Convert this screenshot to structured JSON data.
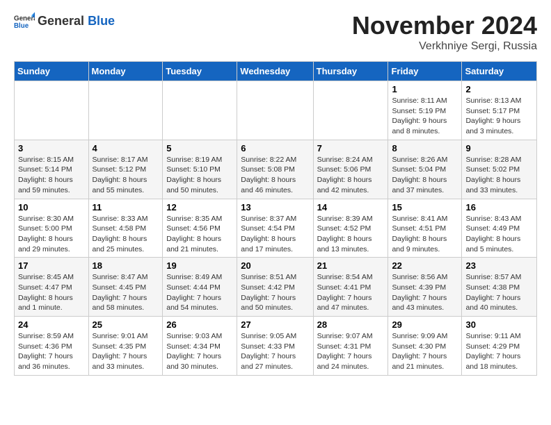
{
  "logo": {
    "general": "General",
    "blue": "Blue"
  },
  "header": {
    "month_title": "November 2024",
    "location": "Verkhniye Sergi, Russia"
  },
  "weekdays": [
    "Sunday",
    "Monday",
    "Tuesday",
    "Wednesday",
    "Thursday",
    "Friday",
    "Saturday"
  ],
  "weeks": [
    [
      {
        "day": "",
        "info": ""
      },
      {
        "day": "",
        "info": ""
      },
      {
        "day": "",
        "info": ""
      },
      {
        "day": "",
        "info": ""
      },
      {
        "day": "",
        "info": ""
      },
      {
        "day": "1",
        "info": "Sunrise: 8:11 AM\nSunset: 5:19 PM\nDaylight: 9 hours\nand 8 minutes."
      },
      {
        "day": "2",
        "info": "Sunrise: 8:13 AM\nSunset: 5:17 PM\nDaylight: 9 hours\nand 3 minutes."
      }
    ],
    [
      {
        "day": "3",
        "info": "Sunrise: 8:15 AM\nSunset: 5:14 PM\nDaylight: 8 hours\nand 59 minutes."
      },
      {
        "day": "4",
        "info": "Sunrise: 8:17 AM\nSunset: 5:12 PM\nDaylight: 8 hours\nand 55 minutes."
      },
      {
        "day": "5",
        "info": "Sunrise: 8:19 AM\nSunset: 5:10 PM\nDaylight: 8 hours\nand 50 minutes."
      },
      {
        "day": "6",
        "info": "Sunrise: 8:22 AM\nSunset: 5:08 PM\nDaylight: 8 hours\nand 46 minutes."
      },
      {
        "day": "7",
        "info": "Sunrise: 8:24 AM\nSunset: 5:06 PM\nDaylight: 8 hours\nand 42 minutes."
      },
      {
        "day": "8",
        "info": "Sunrise: 8:26 AM\nSunset: 5:04 PM\nDaylight: 8 hours\nand 37 minutes."
      },
      {
        "day": "9",
        "info": "Sunrise: 8:28 AM\nSunset: 5:02 PM\nDaylight: 8 hours\nand 33 minutes."
      }
    ],
    [
      {
        "day": "10",
        "info": "Sunrise: 8:30 AM\nSunset: 5:00 PM\nDaylight: 8 hours\nand 29 minutes."
      },
      {
        "day": "11",
        "info": "Sunrise: 8:33 AM\nSunset: 4:58 PM\nDaylight: 8 hours\nand 25 minutes."
      },
      {
        "day": "12",
        "info": "Sunrise: 8:35 AM\nSunset: 4:56 PM\nDaylight: 8 hours\nand 21 minutes."
      },
      {
        "day": "13",
        "info": "Sunrise: 8:37 AM\nSunset: 4:54 PM\nDaylight: 8 hours\nand 17 minutes."
      },
      {
        "day": "14",
        "info": "Sunrise: 8:39 AM\nSunset: 4:52 PM\nDaylight: 8 hours\nand 13 minutes."
      },
      {
        "day": "15",
        "info": "Sunrise: 8:41 AM\nSunset: 4:51 PM\nDaylight: 8 hours\nand 9 minutes."
      },
      {
        "day": "16",
        "info": "Sunrise: 8:43 AM\nSunset: 4:49 PM\nDaylight: 8 hours\nand 5 minutes."
      }
    ],
    [
      {
        "day": "17",
        "info": "Sunrise: 8:45 AM\nSunset: 4:47 PM\nDaylight: 8 hours\nand 1 minute."
      },
      {
        "day": "18",
        "info": "Sunrise: 8:47 AM\nSunset: 4:45 PM\nDaylight: 7 hours\nand 58 minutes."
      },
      {
        "day": "19",
        "info": "Sunrise: 8:49 AM\nSunset: 4:44 PM\nDaylight: 7 hours\nand 54 minutes."
      },
      {
        "day": "20",
        "info": "Sunrise: 8:51 AM\nSunset: 4:42 PM\nDaylight: 7 hours\nand 50 minutes."
      },
      {
        "day": "21",
        "info": "Sunrise: 8:54 AM\nSunset: 4:41 PM\nDaylight: 7 hours\nand 47 minutes."
      },
      {
        "day": "22",
        "info": "Sunrise: 8:56 AM\nSunset: 4:39 PM\nDaylight: 7 hours\nand 43 minutes."
      },
      {
        "day": "23",
        "info": "Sunrise: 8:57 AM\nSunset: 4:38 PM\nDaylight: 7 hours\nand 40 minutes."
      }
    ],
    [
      {
        "day": "24",
        "info": "Sunrise: 8:59 AM\nSunset: 4:36 PM\nDaylight: 7 hours\nand 36 minutes."
      },
      {
        "day": "25",
        "info": "Sunrise: 9:01 AM\nSunset: 4:35 PM\nDaylight: 7 hours\nand 33 minutes."
      },
      {
        "day": "26",
        "info": "Sunrise: 9:03 AM\nSunset: 4:34 PM\nDaylight: 7 hours\nand 30 minutes."
      },
      {
        "day": "27",
        "info": "Sunrise: 9:05 AM\nSunset: 4:33 PM\nDaylight: 7 hours\nand 27 minutes."
      },
      {
        "day": "28",
        "info": "Sunrise: 9:07 AM\nSunset: 4:31 PM\nDaylight: 7 hours\nand 24 minutes."
      },
      {
        "day": "29",
        "info": "Sunrise: 9:09 AM\nSunset: 4:30 PM\nDaylight: 7 hours\nand 21 minutes."
      },
      {
        "day": "30",
        "info": "Sunrise: 9:11 AM\nSunset: 4:29 PM\nDaylight: 7 hours\nand 18 minutes."
      }
    ]
  ]
}
